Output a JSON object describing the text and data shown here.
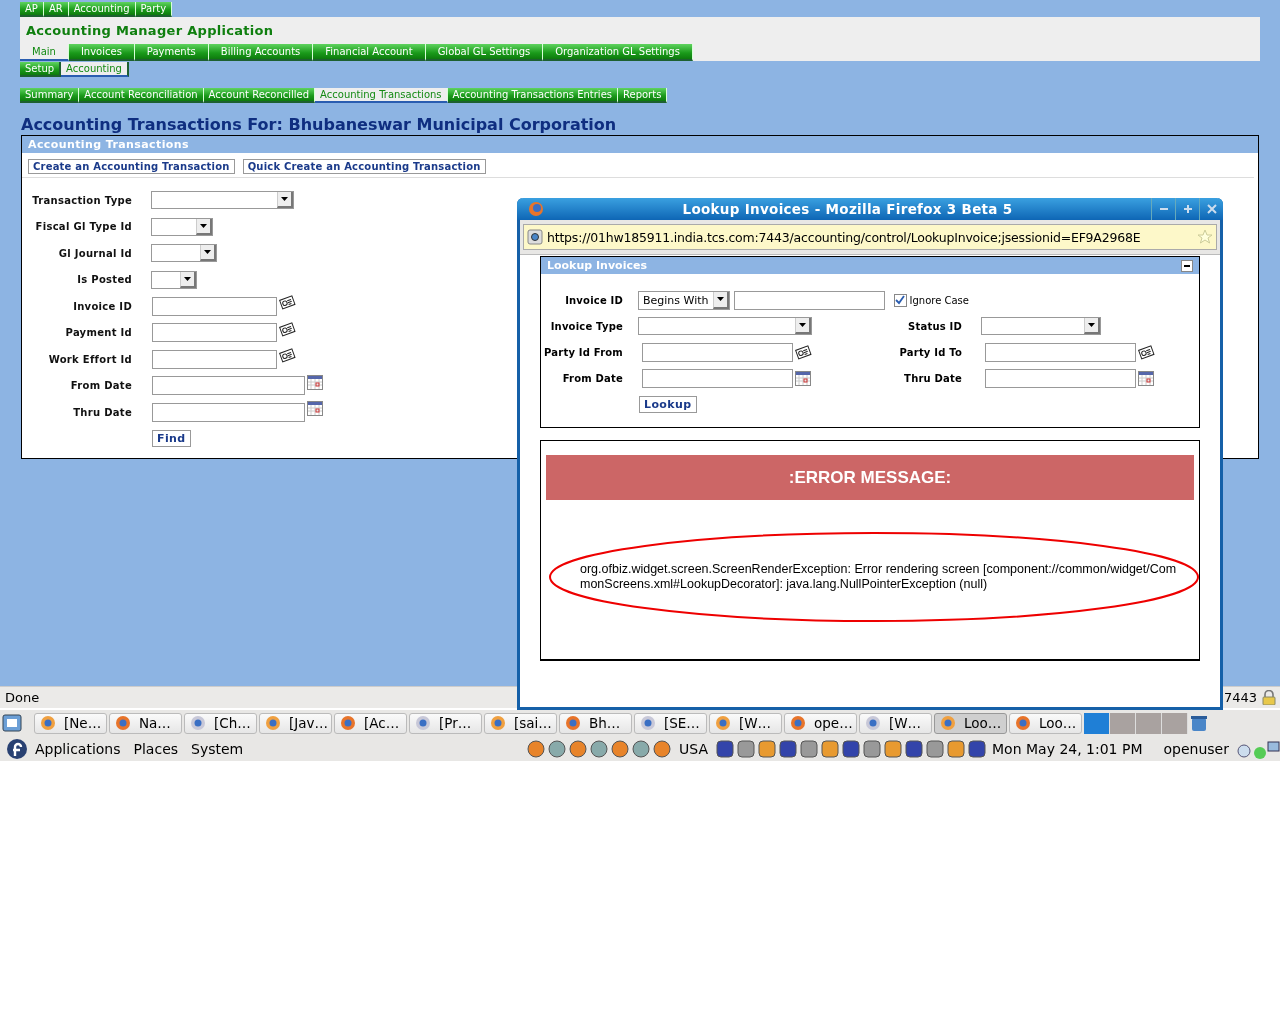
{
  "app_tabs": [
    "AP",
    "AR",
    "Accounting",
    "Party"
  ],
  "app_title": "Accounting Manager Application",
  "main_tabs": [
    {
      "label": "Main",
      "selected": true
    },
    {
      "label": "Invoices",
      "selected": false
    },
    {
      "label": "Payments",
      "selected": false
    },
    {
      "label": "Billing Accounts",
      "selected": false
    },
    {
      "label": "Financial Account",
      "selected": false
    },
    {
      "label": "Global GL Settings",
      "selected": false
    },
    {
      "label": "Organization GL Settings",
      "selected": false
    }
  ],
  "sub_tabs": [
    {
      "label": "Setup",
      "selected": false
    },
    {
      "label": "Accounting",
      "selected": true
    }
  ],
  "section_tabs": [
    {
      "label": "Summary",
      "selected": false
    },
    {
      "label": "Account Reconciliation",
      "selected": false
    },
    {
      "label": "Account Reconcilled",
      "selected": false
    },
    {
      "label": "Accounting Transactions",
      "selected": true
    },
    {
      "label": "Accounting Transactions Entries",
      "selected": false
    },
    {
      "label": "Reports",
      "selected": false
    }
  ],
  "page_heading": "Accounting Transactions For: Bhubaneswar Municipal Corporation",
  "panel": {
    "title": "Accounting Transactions",
    "links": [
      "Create an Accounting Transaction",
      "Quick Create an Accounting Transaction"
    ],
    "fields": [
      {
        "label": "Transaction Type",
        "kind": "select"
      },
      {
        "label": "Fiscal Gl Type Id",
        "kind": "select"
      },
      {
        "label": "Gl Journal Id",
        "kind": "select"
      },
      {
        "label": "Is Posted",
        "kind": "select"
      },
      {
        "label": "Invoice ID",
        "kind": "lookup"
      },
      {
        "label": "Payment Id",
        "kind": "lookup"
      },
      {
        "label": "Work Effort Id",
        "kind": "lookup"
      },
      {
        "label": "From Date",
        "kind": "date"
      },
      {
        "label": "Thru Date",
        "kind": "date"
      }
    ],
    "find_button": "Find"
  },
  "popup": {
    "title": "Lookup Invoices - Mozilla Firefox 3 Beta 5",
    "url": "https://01hw185911.india.tcs.com:7443/accounting/control/LookupInvoice;jsessionid=EF9A2968E",
    "section_title": "Lookup Invoices",
    "invoice_id": {
      "label": "Invoice ID",
      "operator": "Begins With",
      "ignore_case_label": "Ignore Case",
      "ignore_case_checked": true
    },
    "rows": [
      [
        {
          "label": "Invoice Type",
          "kind": "select"
        },
        {
          "label": "Status ID",
          "kind": "select"
        }
      ],
      [
        {
          "label": "Party Id From",
          "kind": "lookup"
        },
        {
          "label": "Party Id To",
          "kind": "lookup"
        }
      ],
      [
        {
          "label": "From Date",
          "kind": "date"
        },
        {
          "label": "Thru Date",
          "kind": "date"
        }
      ]
    ],
    "lookup_button": "Lookup",
    "error_title": ":ERROR MESSAGE:",
    "error_text": "org.ofbiz.widget.screen.ScreenRenderException: Error rendering screen [component://common/widget/CommonScreens.xml#LookupDecorator]: java.lang.NullPointerException (null)"
  },
  "status_bar": {
    "text": "Done",
    "port": "7443"
  },
  "taskbar": [
    {
      "label": "[Ne…",
      "selected": false
    },
    {
      "label": "Na…",
      "selected": false
    },
    {
      "label": "[Ch…",
      "selected": false
    },
    {
      "label": "[Jav…",
      "selected": false
    },
    {
      "label": "[Ac…",
      "selected": false
    },
    {
      "label": "[Pr…",
      "selected": false
    },
    {
      "label": "[sai…",
      "selected": false
    },
    {
      "label": "Bh…",
      "selected": false
    },
    {
      "label": "[SE…",
      "selected": false
    },
    {
      "label": "[W…",
      "selected": false
    },
    {
      "label": "ope…",
      "selected": false
    },
    {
      "label": "[W…",
      "selected": false
    },
    {
      "label": "Loo…",
      "selected": true
    },
    {
      "label": "Loo…",
      "selected": false
    }
  ],
  "panel_bar": {
    "menus": [
      "Applications",
      "Places",
      "System"
    ],
    "keyboard": "USA",
    "clock": "Mon May 24,  1:01 PM",
    "user": "openuser"
  }
}
